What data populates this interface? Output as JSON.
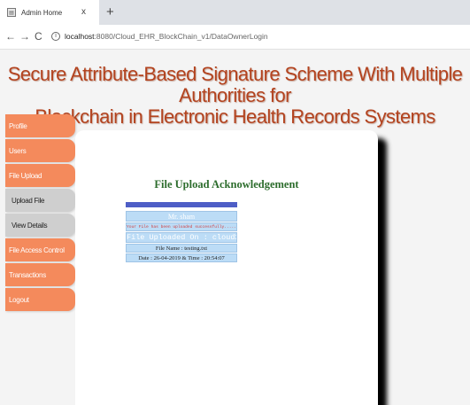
{
  "browser": {
    "tab_title": "Admin Home",
    "tab_close": "x",
    "new_tab": "+",
    "back": "←",
    "forward": "→",
    "reload": "C",
    "url_host": "localhost",
    "url_rest": ":8080/Cloud_EHR_BlockChain_v1/DataOwnerLogin"
  },
  "page": {
    "title_line1": "Secure Attribute-Based Signature Scheme With Multiple Authorities for",
    "title_line2": "Blockchain in Electronic Health Records Systems"
  },
  "sidebar": {
    "items": [
      {
        "label": "Profile",
        "style": "orange"
      },
      {
        "label": "Users",
        "style": "orange"
      },
      {
        "label": "File Upload",
        "style": "orange"
      },
      {
        "label": "Upload File",
        "style": "grey"
      },
      {
        "label": "View Details",
        "style": "grey"
      },
      {
        "label": "File Access Control",
        "style": "orange"
      },
      {
        "label": "Transactions",
        "style": "orange"
      },
      {
        "label": "Logout",
        "style": "orange"
      }
    ]
  },
  "ack": {
    "title": "File Upload Acknowledgement",
    "owner": "Mr. sham",
    "message": "Your File has been uploaded successfully.....",
    "cloud": "File Uploaded On : cloud2",
    "file_name": "File Name : testing.txt",
    "date_time": "Date : 26-04-2019 & Time : 20:54:07"
  },
  "colors": {
    "title": "#b3431f",
    "menu_orange": "#f48a5c",
    "menu_grey": "#cfcfcf",
    "ack_title": "#2d6d2d",
    "ack_bar": "#4e5ec6",
    "ack_row": "#bcdcf6"
  }
}
